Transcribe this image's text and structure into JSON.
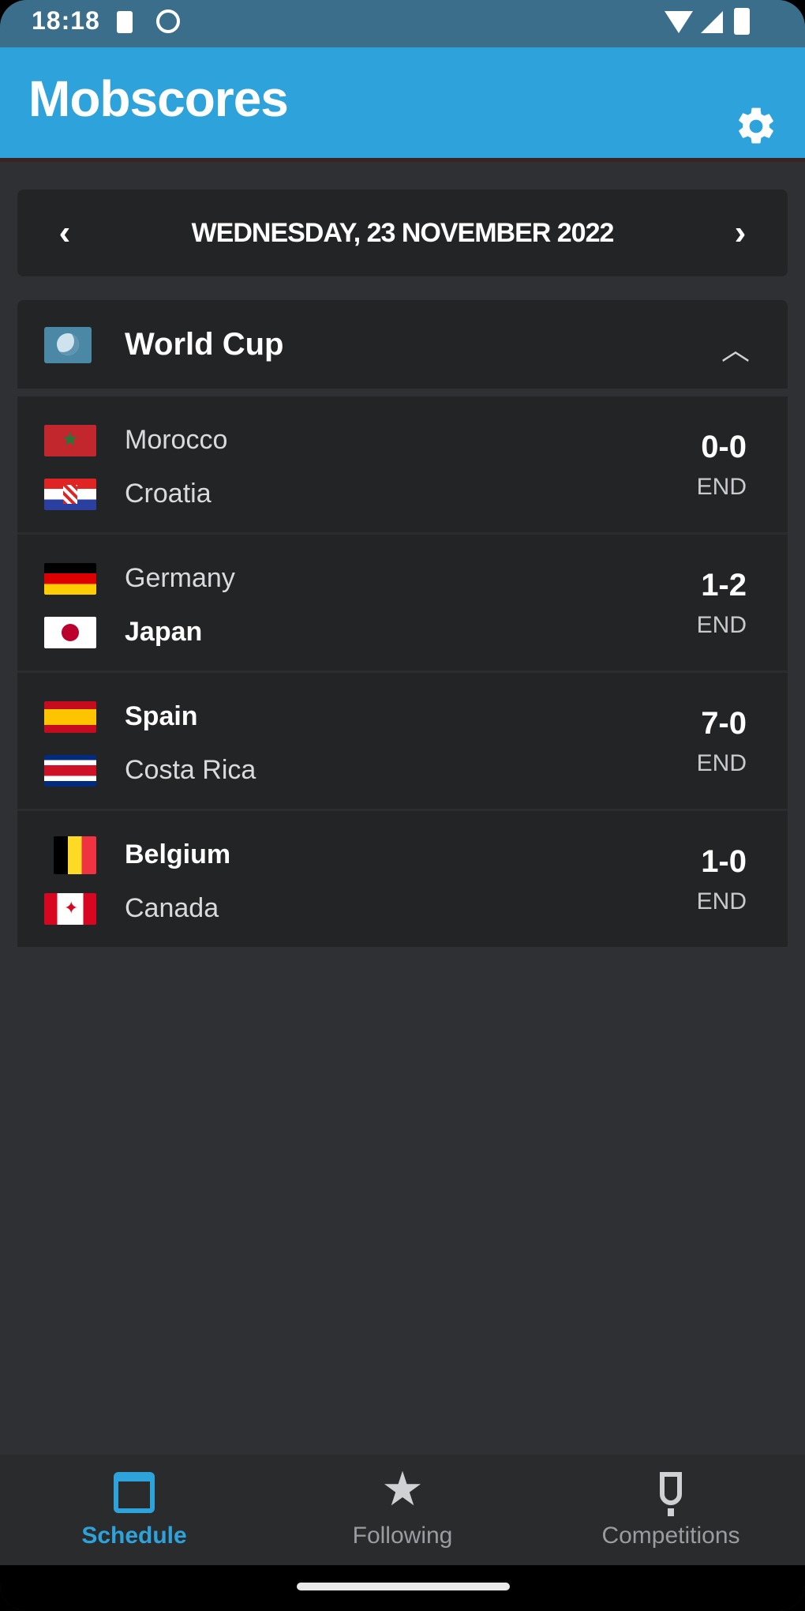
{
  "status_bar": {
    "time": "18:18",
    "icons": [
      "sim-card-icon",
      "face-icon",
      "wifi-icon",
      "signal-icon",
      "battery-icon"
    ]
  },
  "app": {
    "title": "Mobscores",
    "settings_icon": "gear-icon",
    "brand_color": "#2ea3db"
  },
  "date_nav": {
    "prev_label": "‹",
    "next_label": "›",
    "date": "WEDNESDAY, 23 NOVEMBER 2022"
  },
  "competition": {
    "name": "World Cup",
    "icon": "globe-icon",
    "collapse_label": "︿",
    "matches": [
      {
        "home": "Morocco",
        "away": "Croatia",
        "score": "0-0",
        "status": "END",
        "home_flag": "morocco-flag-icon",
        "away_flag": "croatia-flag-icon"
      },
      {
        "home": "Germany",
        "away": "Japan",
        "score": "1-2",
        "status": "END",
        "home_flag": "germany-flag-icon",
        "away_flag": "japan-flag-icon"
      },
      {
        "home": "Spain",
        "away": "Costa Rica",
        "score": "7-0",
        "status": "END",
        "home_flag": "spain-flag-icon",
        "away_flag": "costa-rica-flag-icon"
      },
      {
        "home": "Belgium",
        "away": "Canada",
        "score": "1-0",
        "status": "END",
        "home_flag": "belgium-flag-icon",
        "away_flag": "canada-flag-icon"
      }
    ]
  },
  "bottom_nav": {
    "items": [
      {
        "label": "Schedule",
        "icon": "calendar-icon",
        "active": true
      },
      {
        "label": "Following",
        "icon": "star-icon",
        "active": false
      },
      {
        "label": "Competitions",
        "icon": "trophy-icon",
        "active": false
      }
    ]
  }
}
